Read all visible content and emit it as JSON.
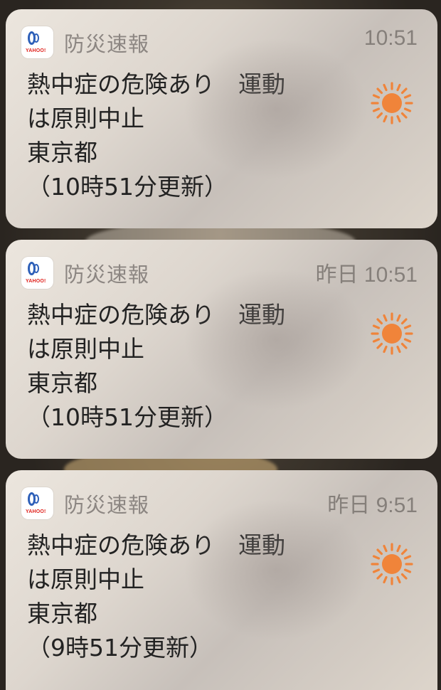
{
  "notifications": [
    {
      "app_name": "防災速報",
      "time": "10:51",
      "line1": "熱中症の危険あり　運動",
      "line2": "は原則中止",
      "line3": "東京都",
      "line4": "（10時51分更新）",
      "icon": "sun-icon"
    },
    {
      "app_name": "防災速報",
      "time": "昨日 10:51",
      "line1": "熱中症の危険あり　運動",
      "line2": "は原則中止",
      "line3": "東京都",
      "line4": "（10時51分更新）",
      "icon": "sun-icon"
    },
    {
      "app_name": "防災速報",
      "time": "昨日 9:51",
      "line1": "熱中症の危険あり　運動",
      "line2": "は原則中止",
      "line3": "東京都",
      "line4": "（9時51分更新）",
      "icon": "sun-icon"
    }
  ],
  "app_icon": {
    "brand": "YAHOO!",
    "name": "yahoo-bousai-icon"
  },
  "colors": {
    "sun": "#f0843a",
    "card": "#e3ddd5",
    "text": "#222222",
    "meta": "#857f7a"
  }
}
